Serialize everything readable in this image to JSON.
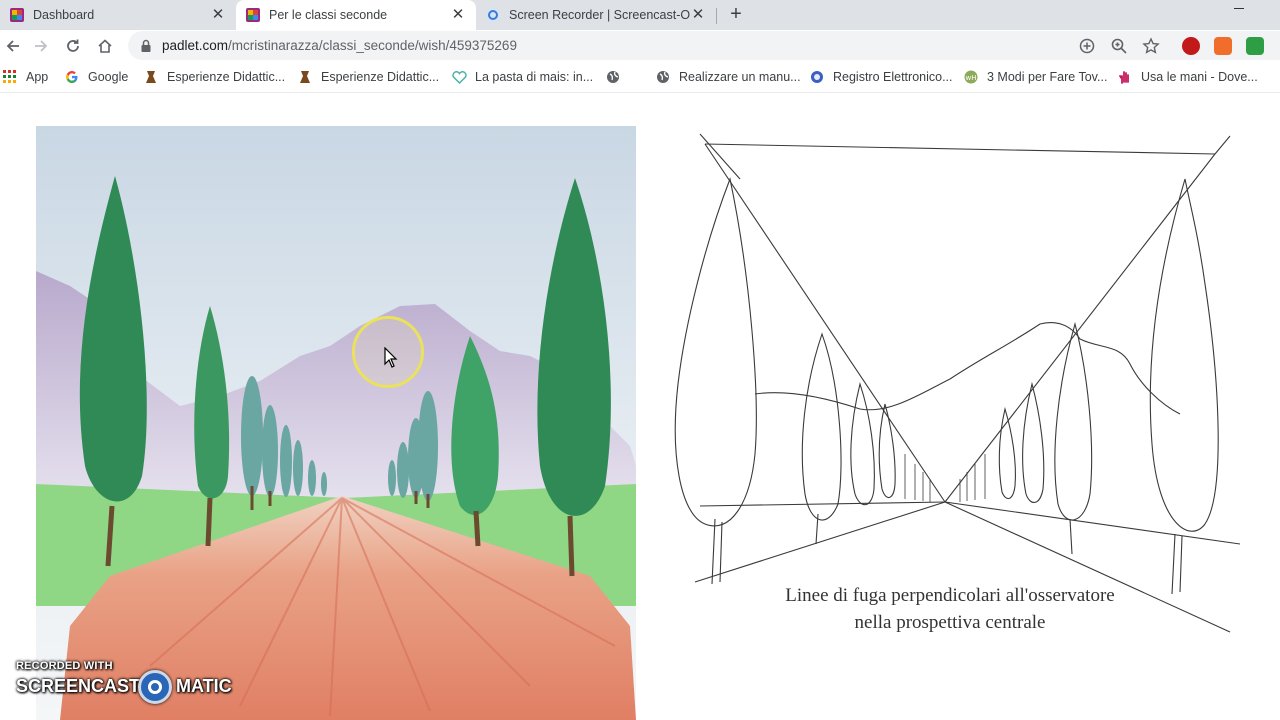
{
  "browser": {
    "tabs": [
      {
        "title": "Dashboard",
        "favicon": "padlet-icon",
        "active": false
      },
      {
        "title": "Per le classi seconde",
        "favicon": "padlet-icon",
        "active": true
      },
      {
        "title": "Screen Recorder | Screencast-O-M",
        "favicon": "screencast-icon",
        "active": false
      }
    ],
    "address": {
      "host": "padlet.com",
      "path": "/mcristinarazza/classi_seconde/wish/459375269"
    },
    "bookmarks": [
      {
        "label": "App",
        "icon": "apps-grid-icon"
      },
      {
        "label": "Google",
        "icon": "google-icon"
      },
      {
        "label": "Esperienze Didattic...",
        "icon": "bookmark-site-icon"
      },
      {
        "label": "Esperienze Didattic...",
        "icon": "bookmark-site-icon"
      },
      {
        "label": "La pasta di mais: in...",
        "icon": "heart-icon"
      },
      {
        "label": "",
        "icon": "globe-icon"
      },
      {
        "label": "Realizzare un manu...",
        "icon": "globe-icon"
      },
      {
        "label": "Registro Elettronico...",
        "icon": "globe-icon"
      },
      {
        "label": "3 Modi per Fare Tov...",
        "icon": "wikihow-icon"
      },
      {
        "label": "Usa le mani - Dove...",
        "icon": "hand-icon"
      }
    ]
  },
  "content": {
    "caption_line1": "Linee di fuga perpendicolari all'osservatore",
    "caption_line2": "nella prospettiva centrale",
    "painting_alt": "watercolor-avenue-of-cypresses",
    "drawing_alt": "perspective-line-drawing"
  },
  "watermark": {
    "recorded": "RECORDED WITH",
    "left": "SCREENCAST",
    "right": "MATIC"
  },
  "colors": {
    "accent_sky": "#dfe8ef",
    "cypress": "#2f8a55",
    "road": "#e58f74",
    "grass": "#8fd685",
    "mountain": "#c8bcd6",
    "highlight_ring": "#eae25a"
  }
}
